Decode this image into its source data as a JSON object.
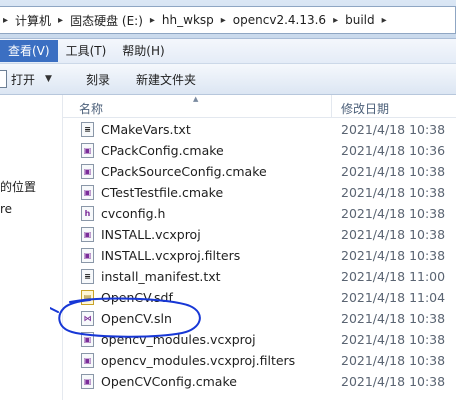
{
  "breadcrumb": {
    "items": [
      "计算机",
      "固态硬盘 (E:)",
      "hh_wksp",
      "opencv2.4.13.6",
      "build"
    ]
  },
  "menu": {
    "items": [
      {
        "label": "查看(V)",
        "active": true
      },
      {
        "label": "工具(T)",
        "active": false
      },
      {
        "label": "帮助(H)",
        "active": false
      }
    ]
  },
  "toolbar": {
    "open_label": "打开",
    "burn_label": "刻录",
    "new_folder_label": "新建文件夹"
  },
  "nav": {
    "recent_places": "的位置",
    "partial_item": "re"
  },
  "columns": {
    "name": "名称",
    "modified": "修改日期"
  },
  "files": [
    {
      "name": "CMakeVars.txt",
      "date": "2021/4/18 10:38",
      "icon": "text-file-icon"
    },
    {
      "name": "CPackConfig.cmake",
      "date": "2021/4/18 10:36",
      "icon": "cmake-file-icon"
    },
    {
      "name": "CPackSourceConfig.cmake",
      "date": "2021/4/18 10:38",
      "icon": "cmake-file-icon"
    },
    {
      "name": "CTestTestfile.cmake",
      "date": "2021/4/18 10:38",
      "icon": "cmake-file-icon"
    },
    {
      "name": "cvconfig.h",
      "date": "2021/4/18 10:38",
      "icon": "header-file-icon"
    },
    {
      "name": "INSTALL.vcxproj",
      "date": "2021/4/18 10:38",
      "icon": "vcxproj-file-icon"
    },
    {
      "name": "INSTALL.vcxproj.filters",
      "date": "2021/4/18 10:38",
      "icon": "filters-file-icon"
    },
    {
      "name": "install_manifest.txt",
      "date": "2021/4/18 11:00",
      "icon": "text-file-icon"
    },
    {
      "name": "OpenCV.sdf",
      "date": "2021/4/18 11:04",
      "icon": "database-file-icon"
    },
    {
      "name": "OpenCV.sln",
      "date": "2021/4/18 10:38",
      "icon": "vs-solution-icon"
    },
    {
      "name": "opencv_modules.vcxproj",
      "date": "2021/4/18 10:38",
      "icon": "vcxproj-file-icon"
    },
    {
      "name": "opencv_modules.vcxproj.filters",
      "date": "2021/4/18 10:38",
      "icon": "filters-file-icon"
    },
    {
      "name": "OpenCVConfig.cmake",
      "date": "2021/4/18 10:38",
      "icon": "cmake-file-icon"
    }
  ]
}
